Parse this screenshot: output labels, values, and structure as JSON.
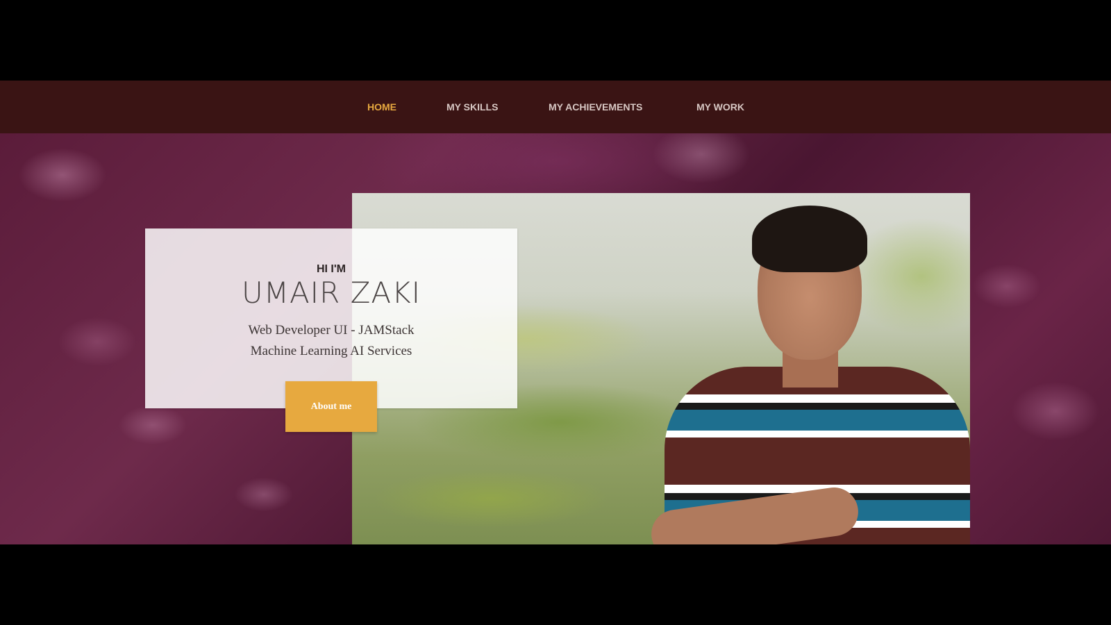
{
  "nav": {
    "items": [
      {
        "label": "HOME",
        "active": true
      },
      {
        "label": "MY SKILLS",
        "active": false
      },
      {
        "label": "MY ACHIEVEMENTS",
        "active": false
      },
      {
        "label": "MY WORK",
        "active": false
      }
    ]
  },
  "hero": {
    "greeting": "HI I'M",
    "name": "UMAIR ZAKI",
    "tagline_line1": "Web Developer UI - JAMStack",
    "tagline_line2": "Machine Learning AI Services",
    "cta_label": "About me"
  },
  "colors": {
    "nav_background": "#3a1414",
    "nav_active": "#e7a93f",
    "nav_text": "#d8c8c4",
    "accent": "#e7a93f",
    "card_background": "#ffffff"
  },
  "icons": {
    "hero_background": "leaf-water-droplets-image",
    "portrait": "person-portrait-photo"
  }
}
